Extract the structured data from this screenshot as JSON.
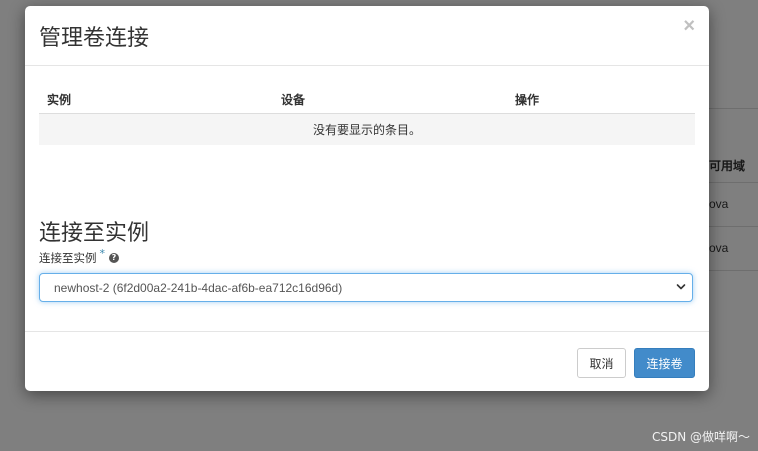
{
  "background": {
    "header_fragment": "可用域",
    "row1_fragment": "ova",
    "row2_fragment": "ova"
  },
  "modal": {
    "title": "管理卷连接",
    "close_glyph": "×",
    "table": {
      "headers": [
        "实例",
        "设备",
        "操作"
      ],
      "empty_message": "没有要显示的条目。"
    },
    "attach_section": {
      "title": "连接至实例",
      "field_label": "连接至实例",
      "required_marker": "*",
      "help_glyph": "?",
      "selected_instance": "newhost-2 (6f2d00a2-241b-4dac-af6b-ea712c16d96d)"
    },
    "footer": {
      "cancel_label": "取消",
      "submit_label": "连接卷"
    }
  },
  "watermark": "CSDN @做咩啊～",
  "colors": {
    "primary": "#428bca",
    "focus_border": "#66afe9",
    "required": "#3a87ad"
  }
}
